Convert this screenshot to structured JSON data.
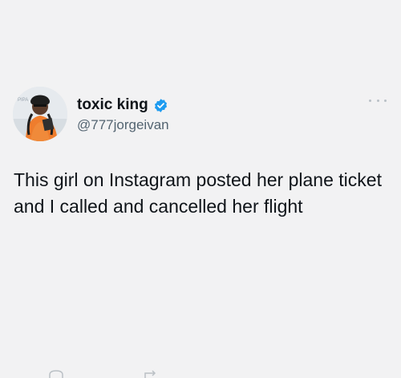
{
  "tweet": {
    "author": {
      "display_name": "toxic king",
      "handle": "@777jorgeivan",
      "verified_icon": "verified-badge-icon",
      "verified_color": "#1d9bf0"
    },
    "text": "This girl on Instagram posted her plane ticket and I called and cancelled her flight",
    "more_icon": "more-options-icon"
  },
  "colors": {
    "background": "#f2f2f3",
    "text_primary": "#0f1419",
    "text_secondary": "#536471"
  }
}
